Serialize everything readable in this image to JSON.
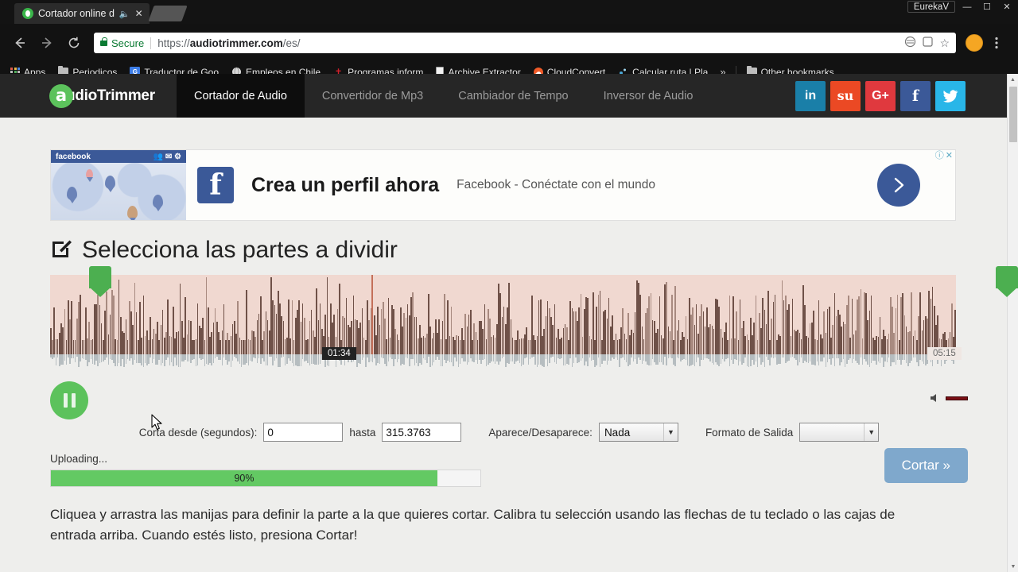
{
  "browser": {
    "tab": {
      "title": "Cortador online d",
      "favicon": "audiotrimmer-favicon",
      "mute_icon": "speaker-icon",
      "close_icon": "close-icon"
    },
    "new_tab_label": "",
    "window": {
      "profile": "EurekaV",
      "minimize": "minimize-icon",
      "maximize": "maximize-icon",
      "close": "close-icon"
    },
    "nav": {
      "back": "back-arrow-icon",
      "forward": "forward-arrow-icon",
      "reload": "reload-icon"
    },
    "omnibox": {
      "secure_label": "Secure",
      "url_scheme": "https://",
      "url_host": "audiotrimmer.com",
      "url_path": "/es/",
      "full_url": "https://audiotrimmer.com/es/"
    },
    "bookmarks": [
      {
        "label": "Apps",
        "icon": "apps-grid-icon"
      },
      {
        "label": "Periodicos",
        "icon": "folder-icon"
      },
      {
        "label": "Traductor de Goo",
        "icon": "google-translate-icon"
      },
      {
        "label": "Empleos en Chile",
        "icon": "globe-icon"
      },
      {
        "label": "Programas inform",
        "icon": "pin-icon"
      },
      {
        "label": "Archive Extractor",
        "icon": "document-icon"
      },
      {
        "label": "CloudConvert",
        "icon": "cloudconvert-icon"
      },
      {
        "label": "Calcular ruta | Pla",
        "icon": "map-icon"
      }
    ],
    "bookmarks_overflow": "»",
    "other_bookmarks": {
      "label": "Other bookmarks",
      "icon": "folder-icon"
    }
  },
  "site": {
    "logo": {
      "mark": "a",
      "text_light": "udio",
      "text_bold": "Trimmer",
      "full": "AudioTrimmer"
    },
    "nav": [
      {
        "label": "Cortador de Audio",
        "active": true
      },
      {
        "label": "Convertidor de Mp3",
        "active": false
      },
      {
        "label": "Cambiador de Tempo",
        "active": false
      },
      {
        "label": "Inversor de Audio",
        "active": false
      }
    ],
    "social": [
      {
        "name": "linkedin",
        "glyph": "in",
        "color": "#1a7fa8"
      },
      {
        "name": "stumbleupon",
        "glyph": "su",
        "color": "#eb4924"
      },
      {
        "name": "googleplus",
        "glyph": "G+",
        "color": "#e0393e"
      },
      {
        "name": "facebook",
        "glyph": "f",
        "color": "#3b5998"
      },
      {
        "name": "twitter",
        "glyph": "t",
        "color": "#29b6e8"
      }
    ]
  },
  "ad": {
    "brand": "facebook",
    "headline": "Crea un perfil ahora",
    "subtext": "Facebook - Conéctate con el mundo",
    "cta_icon": "chevron-right-icon",
    "info_icon": "ⓘ",
    "close_icon": "✕"
  },
  "main": {
    "heading": "Selecciona las partes a dividir",
    "heading_icon": "edit-square-icon",
    "waveform": {
      "current_time": "01:34",
      "total_time": "05:15",
      "left_handle": "selection-start-handle",
      "right_handle": "selection-end-handle"
    },
    "player": {
      "state_icon": "pause-icon",
      "volume_icon": "speaker-icon"
    },
    "form": {
      "from_label": "Corta desde (segundos):",
      "from_value": "0",
      "to_label": "hasta",
      "to_value": "315.3763",
      "fade_label": "Aparece/Desaparece:",
      "fade_value": "Nada",
      "fade_options": [
        "Nada"
      ],
      "format_label": "Formato de Salida",
      "format_value": "",
      "format_options": [
        ""
      ]
    },
    "upload": {
      "status": "Uploading...",
      "percent_label": "90%",
      "percent": 90
    },
    "cut_button": "Cortar »",
    "help_text": "Cliquea y arrastra las manijas para definir la parte a la que quieres cortar. Calibra tu selección usando las flechas de tu teclado o las cajas de entrada arriba. Cuando estés listo, presiona Cortar!"
  },
  "colors": {
    "accent_green": "#5cc25c",
    "wave_bg": "#f0d8d0",
    "wave_bar": "#6f5148",
    "cut_button": "#7fa8cc",
    "progress_fill": "#63c963",
    "header_bg": "#262626"
  }
}
